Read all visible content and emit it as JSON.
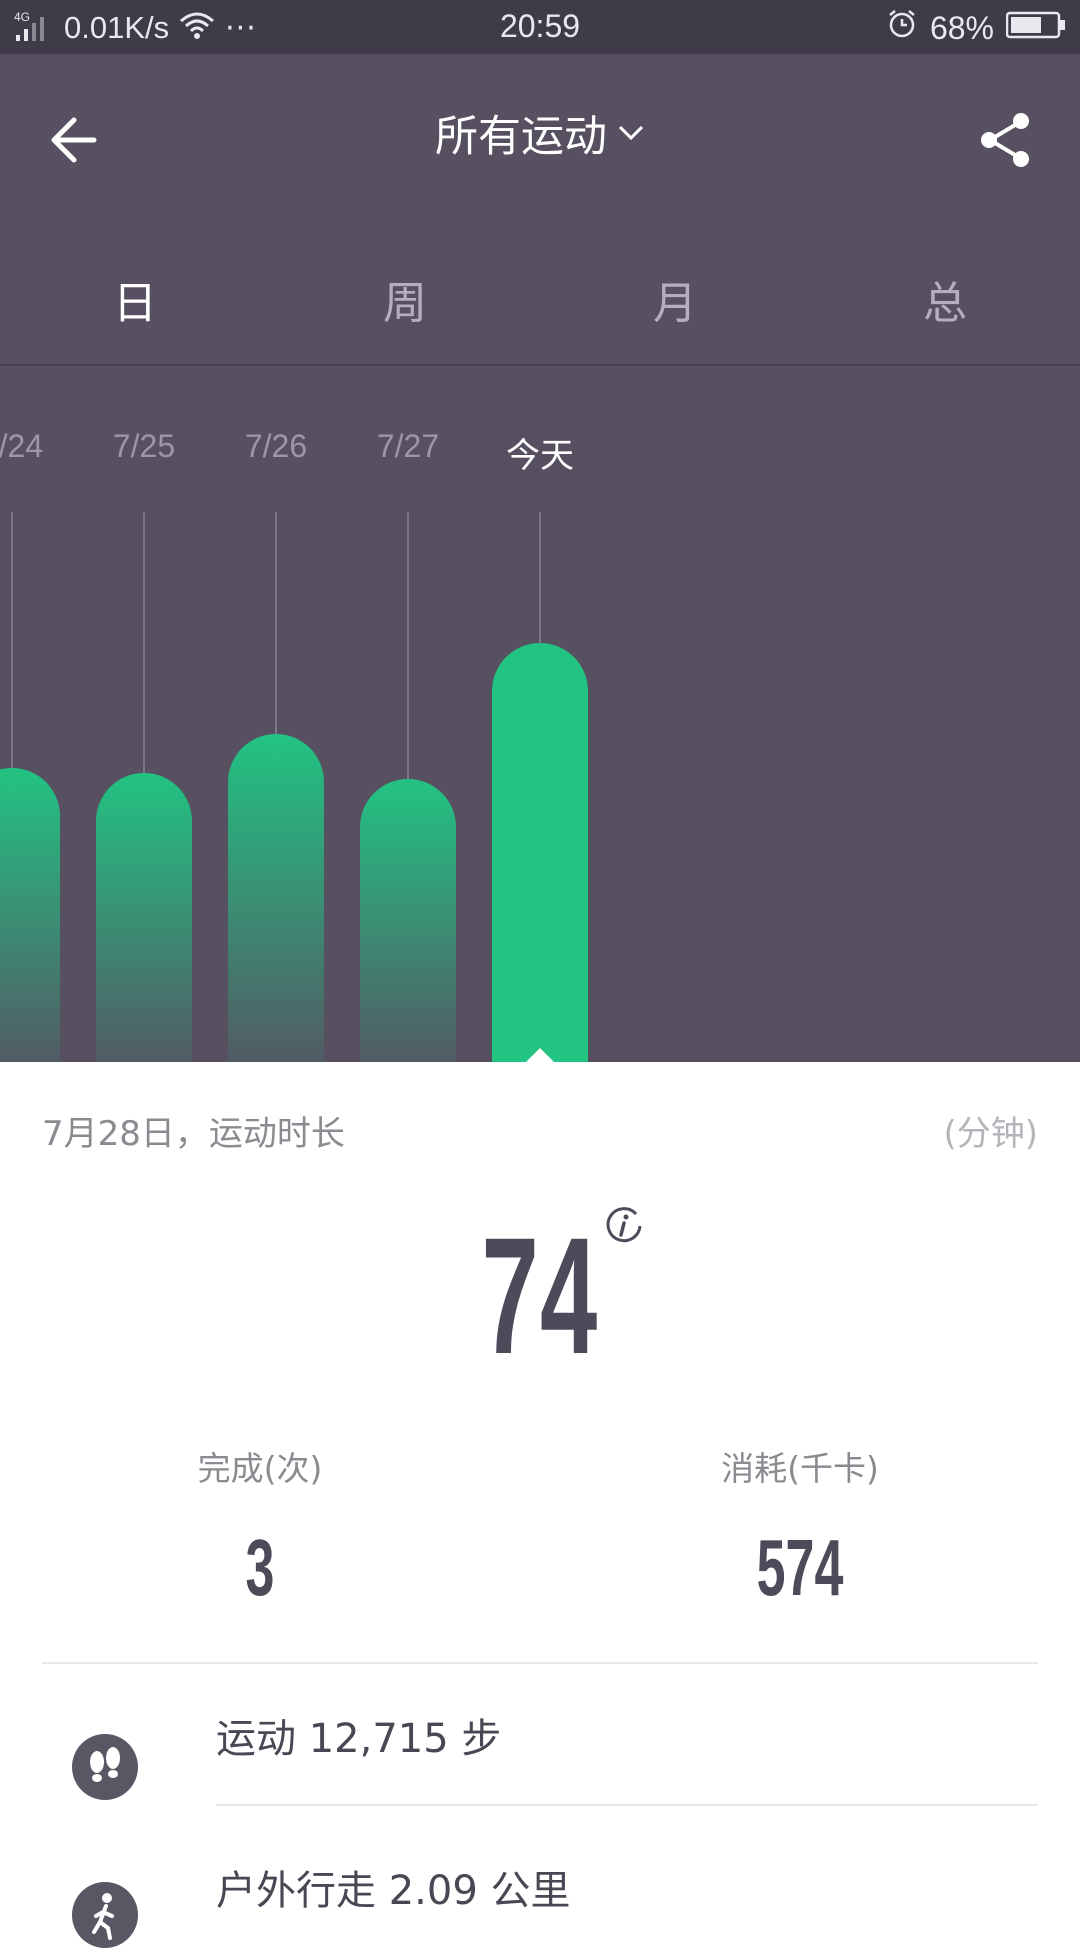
{
  "status_bar": {
    "signal": "4G",
    "network_speed": "0.01K/s",
    "more": "···",
    "time": "20:59",
    "battery_percent": "68%",
    "battery_level": 0.68
  },
  "header": {
    "title": "所有运动",
    "tabs": [
      "日",
      "周",
      "月",
      "总"
    ],
    "active_tab": 0
  },
  "chart_data": {
    "type": "bar",
    "categories": [
      "7/24",
      "7/25",
      "7/26",
      "7/27",
      "今天"
    ],
    "selected": "今天",
    "values": [
      52,
      51,
      58,
      50,
      74
    ],
    "ylim": [
      0,
      100
    ],
    "colors": {
      "bar": "#22c383",
      "background": "#575061"
    }
  },
  "summary": {
    "caption": "7月28日，运动时长",
    "unit": "(分钟)",
    "duration": "74",
    "completed_label": "完成(次)",
    "completed_value": "3",
    "calories_label": "消耗(千卡)",
    "calories_value": "574"
  },
  "activities": [
    {
      "icon": "footprints-icon",
      "text": "运动 12,715 步"
    },
    {
      "icon": "walking-person-icon",
      "text": "户外行走 2.09 公里"
    }
  ]
}
